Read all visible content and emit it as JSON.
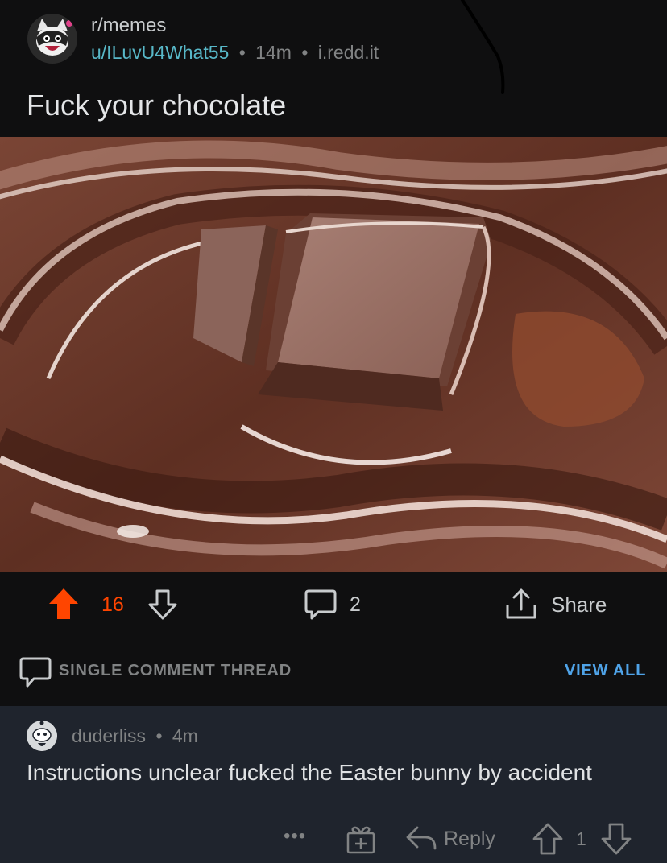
{
  "post": {
    "subreddit": "r/memes",
    "author": "u/ILuvU4What55",
    "meta_separator": "•",
    "age": "14m",
    "domain": "i.redd.it",
    "title": "Fuck your chocolate"
  },
  "actions": {
    "score": "16",
    "comments": "2",
    "share_label": "Share"
  },
  "thread": {
    "label": "SINGLE COMMENT THREAD",
    "view_all": "VIEW ALL"
  },
  "comment": {
    "author": "duderliss",
    "age": "4m",
    "body": "Instructions unclear fucked the Easter bunny by accident",
    "more_label": "•••",
    "reply_label": "Reply",
    "score": "1"
  },
  "colors": {
    "upvote_active": "#ff4500",
    "username": "#58b8c8",
    "link": "#4fa3e8",
    "comment_bg": "#1f242d"
  }
}
